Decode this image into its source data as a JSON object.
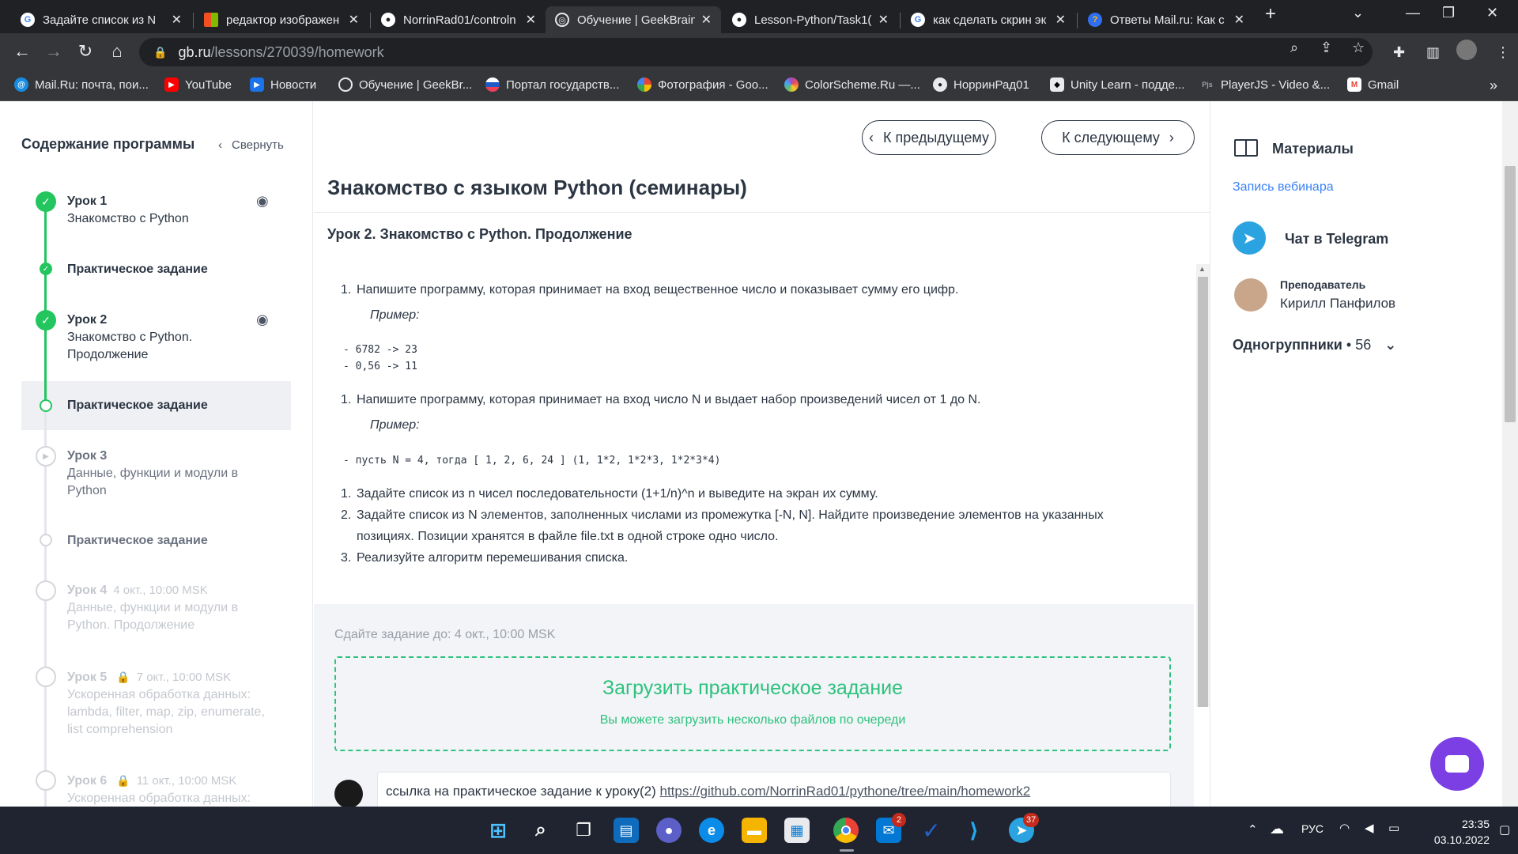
{
  "browser": {
    "tabs": [
      {
        "title": "Задайте список из N",
        "favicon": "google-icon",
        "color": "#4285f4",
        "active": false
      },
      {
        "title": "редактор изображен",
        "favicon": "microsoft-icon",
        "color": "#f25022",
        "active": false
      },
      {
        "title": "NorrinRad01/controln",
        "favicon": "github-icon",
        "color": "#ffffff",
        "active": false
      },
      {
        "title": "Обучение | GeekBrain",
        "favicon": "geekbrains-icon",
        "color": "#ffffff",
        "active": true
      },
      {
        "title": "Lesson-Python/Task1(",
        "favicon": "github-icon",
        "color": "#ffffff",
        "active": false
      },
      {
        "title": "как сделать скрин эк",
        "favicon": "google-icon",
        "color": "#4285f4",
        "active": false
      },
      {
        "title": "Ответы Mail.ru: Как с",
        "favicon": "mailru-answers-icon",
        "color": "#2f6ff0",
        "active": false
      }
    ],
    "url_host": "gb.ru",
    "url_path": "/lessons/270039/homework",
    "bookmarks": [
      {
        "label": "Mail.Ru: почта, пои...",
        "icon": "mailru-icon",
        "color": "#168de2"
      },
      {
        "label": "YouTube",
        "icon": "youtube-icon",
        "color": "#ff0000"
      },
      {
        "label": "Новости",
        "icon": "news-icon",
        "color": "#1a73e8"
      },
      {
        "label": "Обучение | GeekBr...",
        "icon": "geekbrains-icon",
        "color": "#5f6368"
      },
      {
        "label": "Портал государств...",
        "icon": "gosuslugi-icon",
        "color": "#ee3f58"
      },
      {
        "label": "Фотография - Goo...",
        "icon": "google-photos-icon",
        "color": "#fbbc04"
      },
      {
        "label": "ColorScheme.Ru —...",
        "icon": "colorscheme-icon",
        "color": "#ab47bc"
      },
      {
        "label": "НорринРад01",
        "icon": "github-icon",
        "color": "#5f6368"
      },
      {
        "label": "Unity Learn - подде...",
        "icon": "unity-icon",
        "color": "#000000"
      },
      {
        "label": "PlayerJS - Video &...",
        "icon": "playerjs-icon",
        "color": "#35363a"
      },
      {
        "label": "Gmail",
        "icon": "gmail-icon",
        "color": "#ea4335"
      }
    ]
  },
  "sidebar": {
    "title": "Содержание программы",
    "collapse_label": "Свернуть",
    "items": [
      {
        "title": "Урок 1",
        "subtitle": "Знакомство с Python"
      },
      {
        "title": "Практическое задание"
      },
      {
        "title": "Урок 2",
        "subtitle": "Знакомство с Python. Продолжение"
      },
      {
        "title": "Практическое задание"
      },
      {
        "title": "Урок 3",
        "subtitle": "Данные, функции и модули в Python"
      },
      {
        "title": "Практическое задание"
      },
      {
        "title": "Урок 4",
        "date": "4 окт., 10:00 MSK",
        "subtitle": "Данные, функции и модули в Python. Продолжение"
      },
      {
        "title": "Урок 5",
        "date": "7 окт., 10:00 MSK",
        "subtitle": "Ускоренная обработка данных: lambda, filter, map, zip, enumerate, list comprehension"
      },
      {
        "title": "Урок 6",
        "date": "11 окт., 10:00 MSK",
        "subtitle": "Ускоренная обработка данных:"
      }
    ]
  },
  "main": {
    "prev_label": "К предыдущему",
    "next_label": "К следующему",
    "course_title": "Знакомство с языком Python (семинары)",
    "lesson_title": "Урок 2. Знакомство с Python. Продолжение",
    "example_label": "Пример:",
    "tasks": [
      {
        "num": "1.",
        "text": "Напишите программу, которая принимает на вход вещественное число и показывает сумму его цифр."
      },
      {
        "num": "1.",
        "text": "Напишите программу, которая принимает на вход число N и выдает набор произведений чисел от 1 до N."
      },
      {
        "num": "1.",
        "text": "Задайте список из n чисел последовательности (1+1/n)^n и выведите на экран их сумму."
      },
      {
        "num": "2.",
        "text": "Задайте список из N элементов, заполненных числами из промежутка [-N, N]. Найдите произведение элементов на указанных",
        "text2": "позициях. Позиции хранятся в файле file.txt в одной строке одно число."
      },
      {
        "num": "3.",
        "text": "Реализуйте алгоритм перемешивания списка."
      }
    ],
    "code1": [
      "- 6782 -> 23",
      "- 0,56 -> 11"
    ],
    "code2": "- пусть N = 4, тогда [ 1, 2, 6, 24 ] (1, 1*2, 1*2*3, 1*2*3*4)",
    "deadline": "Сдайте задание до: 4 окт., 10:00 MSK",
    "upload_title": "Загрузить практическое задание",
    "upload_sub": "Вы можете загрузить несколько файлов по очереди",
    "comment_text": "ссылка на практическое задание к уроку(2) ",
    "comment_link": "https://github.com/NorrinRad01/pythone/tree/main/homework2"
  },
  "rightbar": {
    "materials": "Материалы",
    "webinar": "Запись вебинара",
    "telegram": "Чат в Telegram",
    "teacher_role": "Преподаватель",
    "teacher_name": "Кирилл Панфилов",
    "classmates_label": "Одногруппники",
    "classmates_count": "56"
  },
  "taskbar": {
    "lang": "РУС",
    "time": "23:35",
    "date": "03.10.2022",
    "badges": {
      "mail": "2",
      "telegram": "37"
    }
  }
}
